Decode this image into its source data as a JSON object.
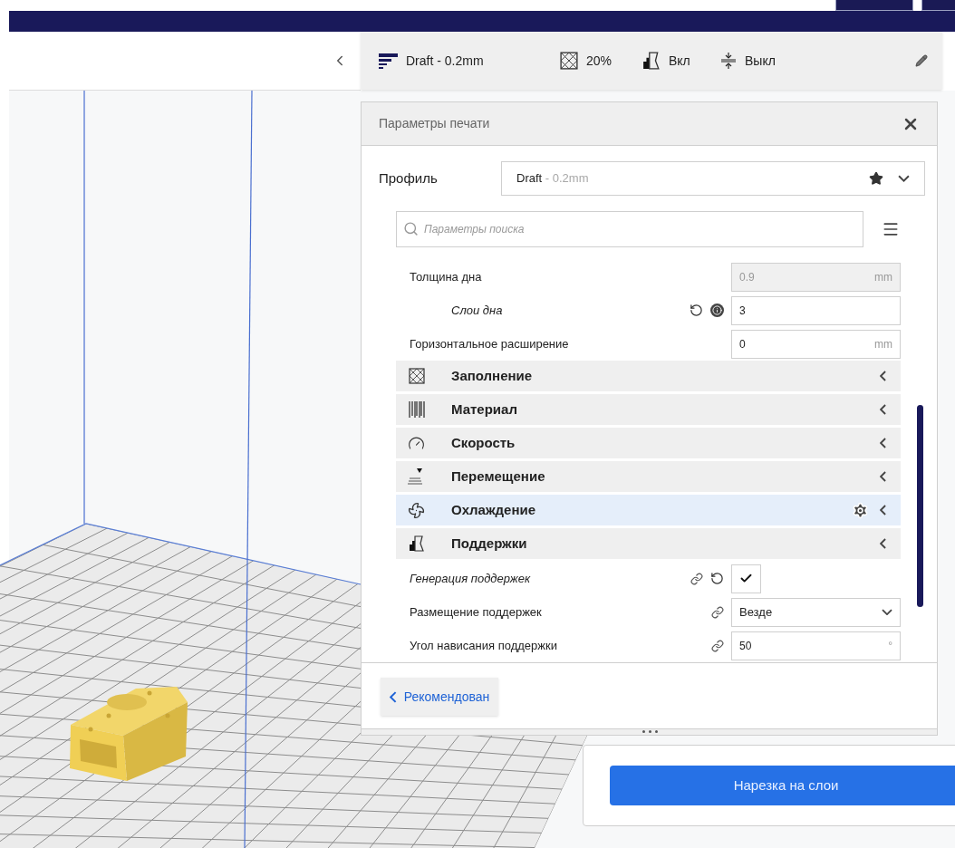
{
  "print_summary": {
    "profile": "Draft - 0.2mm",
    "infill": "20%",
    "support": "Вкл",
    "adhesion": "Выкл"
  },
  "print_settings": {
    "title": "Параметры печати",
    "profile_label": "Профиль",
    "profile_name": "Draft",
    "profile_detail": " - 0.2mm",
    "search": {
      "placeholder": "Параметры поиска"
    },
    "rows": [
      {
        "kind": "setting",
        "label": "Толщина дна",
        "overridden": false,
        "disabled": true,
        "value": "0.9",
        "unit": "mm",
        "children": [
          {
            "kind": "setting",
            "label": "Слои дна",
            "overridden": true,
            "disabled": false,
            "resettable": true,
            "info": true,
            "value": "3"
          }
        ]
      },
      {
        "kind": "setting",
        "label": "Горизонтальное расширение",
        "overridden": false,
        "disabled": false,
        "value": "0",
        "unit": "mm"
      },
      {
        "kind": "category",
        "label": "Заполнение",
        "selected": false
      },
      {
        "kind": "category",
        "label": "Материал",
        "selected": false
      },
      {
        "kind": "category",
        "label": "Скорость",
        "selected": false
      },
      {
        "kind": "category",
        "label": "Перемещение",
        "selected": false
      },
      {
        "kind": "category",
        "label": "Охлаждение",
        "selected": true
      },
      {
        "kind": "category",
        "label": "Поддержки",
        "selected": false
      },
      {
        "kind": "checkbox",
        "label": "Генерация поддержек",
        "overridden": true,
        "linked": true,
        "resettable": true,
        "checked": true
      },
      {
        "kind": "dropdown",
        "label": "Размещение поддержек",
        "overridden": false,
        "linked": true,
        "value": "Везде"
      },
      {
        "kind": "setting",
        "label": "Угол нависания поддержки",
        "overridden": false,
        "disabled": false,
        "linked": true,
        "value": "50",
        "unit": "°"
      }
    ],
    "recommended_button": "Рекомендован"
  },
  "slice_button": "Нарезка на слои"
}
